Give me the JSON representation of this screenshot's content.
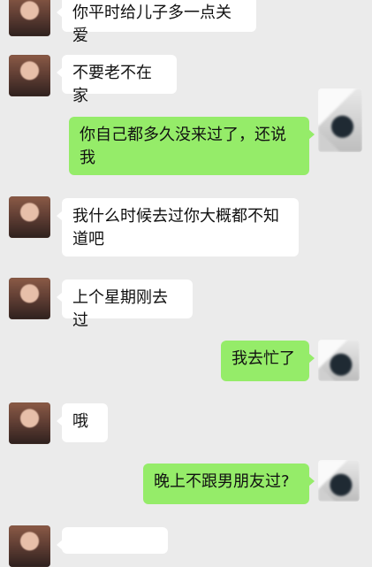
{
  "messages": [
    {
      "side": "in",
      "text": "你平时给儿子多一点关爱"
    },
    {
      "side": "in",
      "text": "不要老不在家"
    },
    {
      "side": "out",
      "text": "你自己都多久没来过了，还说我"
    },
    {
      "side": "in",
      "text": "我什么时候去过你大概都不知道吧"
    },
    {
      "side": "in",
      "text": "上个星期刚去过"
    },
    {
      "side": "out",
      "text": "我去忙了"
    },
    {
      "side": "in",
      "text": "哦"
    },
    {
      "side": "out",
      "text": "晚上不跟男朋友过?"
    }
  ]
}
